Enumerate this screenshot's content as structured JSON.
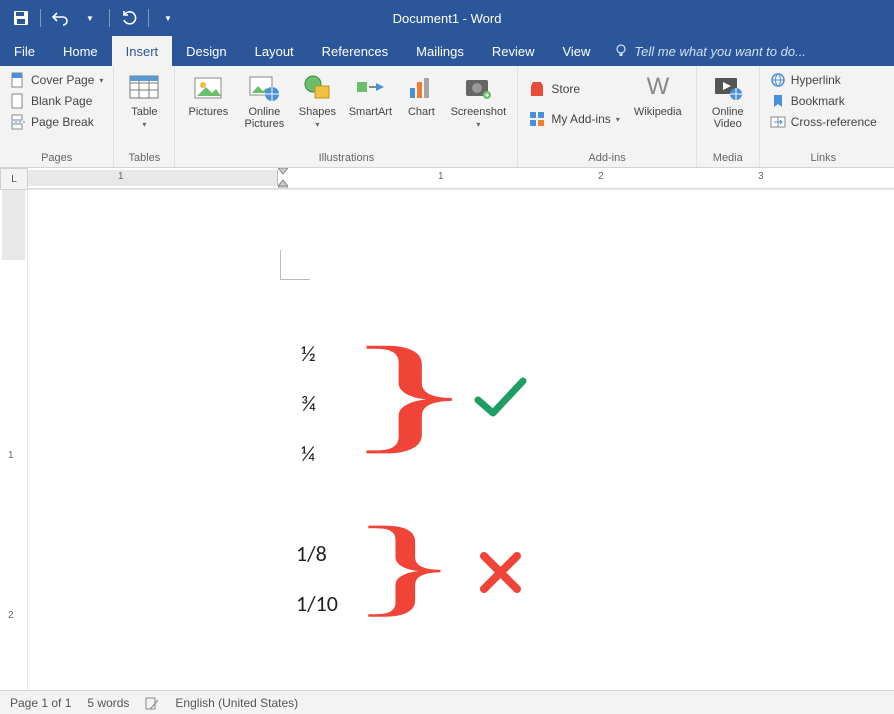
{
  "title": "Document1 - Word",
  "tabs": {
    "file": "File",
    "home": "Home",
    "insert": "Insert",
    "design": "Design",
    "layout": "Layout",
    "references": "References",
    "mailings": "Mailings",
    "review": "Review",
    "view": "View",
    "tellme": "Tell me what you want to do..."
  },
  "ribbon": {
    "pages": {
      "label": "Pages",
      "cover": "Cover Page",
      "blank": "Blank Page",
      "break": "Page Break"
    },
    "tables": {
      "label": "Tables",
      "table": "Table"
    },
    "illus": {
      "label": "Illustrations",
      "pictures": "Pictures",
      "online": "Online Pictures",
      "shapes": "Shapes",
      "smartart": "SmartArt",
      "chart": "Chart",
      "screenshot": "Screenshot"
    },
    "addins": {
      "label": "Add-ins",
      "store": "Store",
      "myaddins": "My Add-ins",
      "wikipedia": "Wikipedia"
    },
    "media": {
      "label": "Media",
      "video": "Online Video"
    },
    "links": {
      "label": "Links",
      "hyperlink": "Hyperlink",
      "bookmark": "Bookmark",
      "crossref": "Cross-reference"
    }
  },
  "ruler": {
    "corner": "L",
    "n1": "1",
    "n2": "2",
    "n3": "3",
    "v1": "1",
    "v2": "2"
  },
  "doc": {
    "f1": "½",
    "f2": "¾",
    "f3": "¼",
    "f4": "1/8",
    "f5": "1/10"
  },
  "status": {
    "page": "Page 1 of 1",
    "words": "5 words",
    "lang": "English (United States)"
  }
}
